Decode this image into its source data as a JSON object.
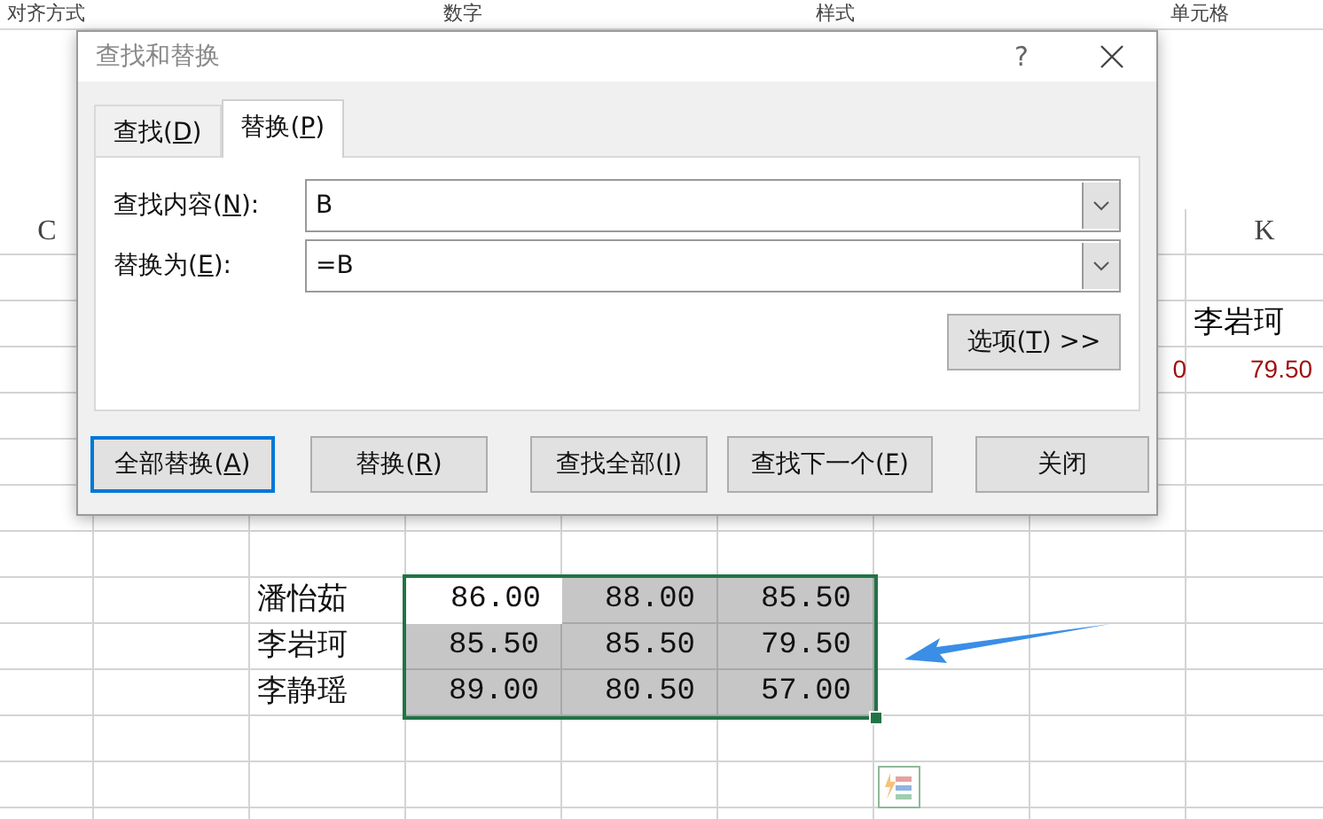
{
  "ribbon_groups": [
    "对齐方式",
    "数字",
    "样式",
    "单元格"
  ],
  "column_headers": [
    "C",
    "K"
  ],
  "side_entries": {
    "name": "李岩珂",
    "fragment": "0",
    "score": "79.50"
  },
  "table": {
    "rows": [
      {
        "name": "潘怡茹",
        "scores": [
          {
            "value": "86.00",
            "active": true
          },
          {
            "value": "88.00",
            "active": false
          },
          {
            "value": "85.50",
            "active": false
          }
        ]
      },
      {
        "name": "李岩珂",
        "scores": [
          {
            "value": "85.50",
            "active": false
          },
          {
            "value": "85.50",
            "active": false
          },
          {
            "value": "79.50",
            "active": false
          }
        ]
      },
      {
        "name": "李静瑶",
        "scores": [
          {
            "value": "89.00",
            "active": false
          },
          {
            "value": "80.50",
            "active": false
          },
          {
            "value": "57.00",
            "active": false
          }
        ]
      }
    ]
  },
  "dialog": {
    "title": "查找和替换",
    "help": "?",
    "tabs": [
      {
        "prefix": "查找(",
        "key": "D",
        "suffix": ")",
        "selected": false
      },
      {
        "prefix": "替换(",
        "key": "P",
        "suffix": ")",
        "selected": true
      }
    ],
    "fields": [
      {
        "prefix": "查找内容(",
        "key": "N",
        "suffix": "):",
        "value": "B"
      },
      {
        "prefix": "替换为(",
        "key": "E",
        "suffix": "):",
        "value": "=B"
      }
    ],
    "options_button": {
      "prefix": "选项(",
      "key": "T",
      "suffix": ") >>"
    },
    "buttons": [
      {
        "prefix": "全部替换(",
        "key": "A",
        "suffix": ")",
        "focused": true
      },
      {
        "prefix": "替换(",
        "key": "R",
        "suffix": ")",
        "focused": false
      },
      {
        "prefix": "查找全部(",
        "key": "I",
        "suffix": ")",
        "focused": false
      },
      {
        "prefix": "查找下一个(",
        "key": "F",
        "suffix": ")",
        "focused": false
      },
      {
        "prefix": "关闭",
        "focused": false
      }
    ]
  }
}
